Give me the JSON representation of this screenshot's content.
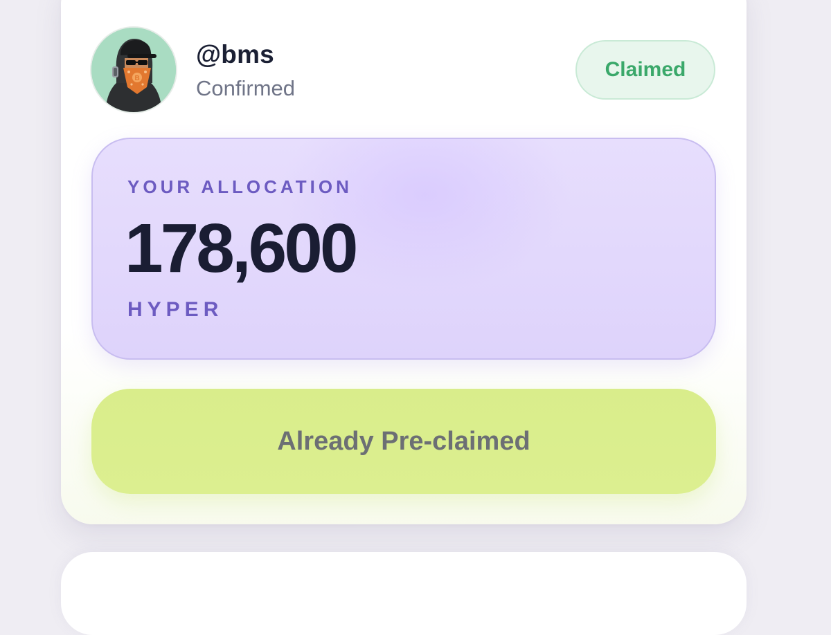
{
  "user": {
    "handle": "@bms",
    "status": "Confirmed",
    "avatar": "avatar-hooded-figure"
  },
  "badge": {
    "label": "Claimed",
    "color": "#3aa86a"
  },
  "allocation": {
    "label": "YOUR ALLOCATION",
    "amount": "178,600",
    "unit": "HYPER"
  },
  "action": {
    "label": "Already Pre-claimed"
  },
  "colors": {
    "accent_purple": "#6c5bc1",
    "button_lime": "#d9ed8b",
    "badge_green": "#3aa86a"
  }
}
